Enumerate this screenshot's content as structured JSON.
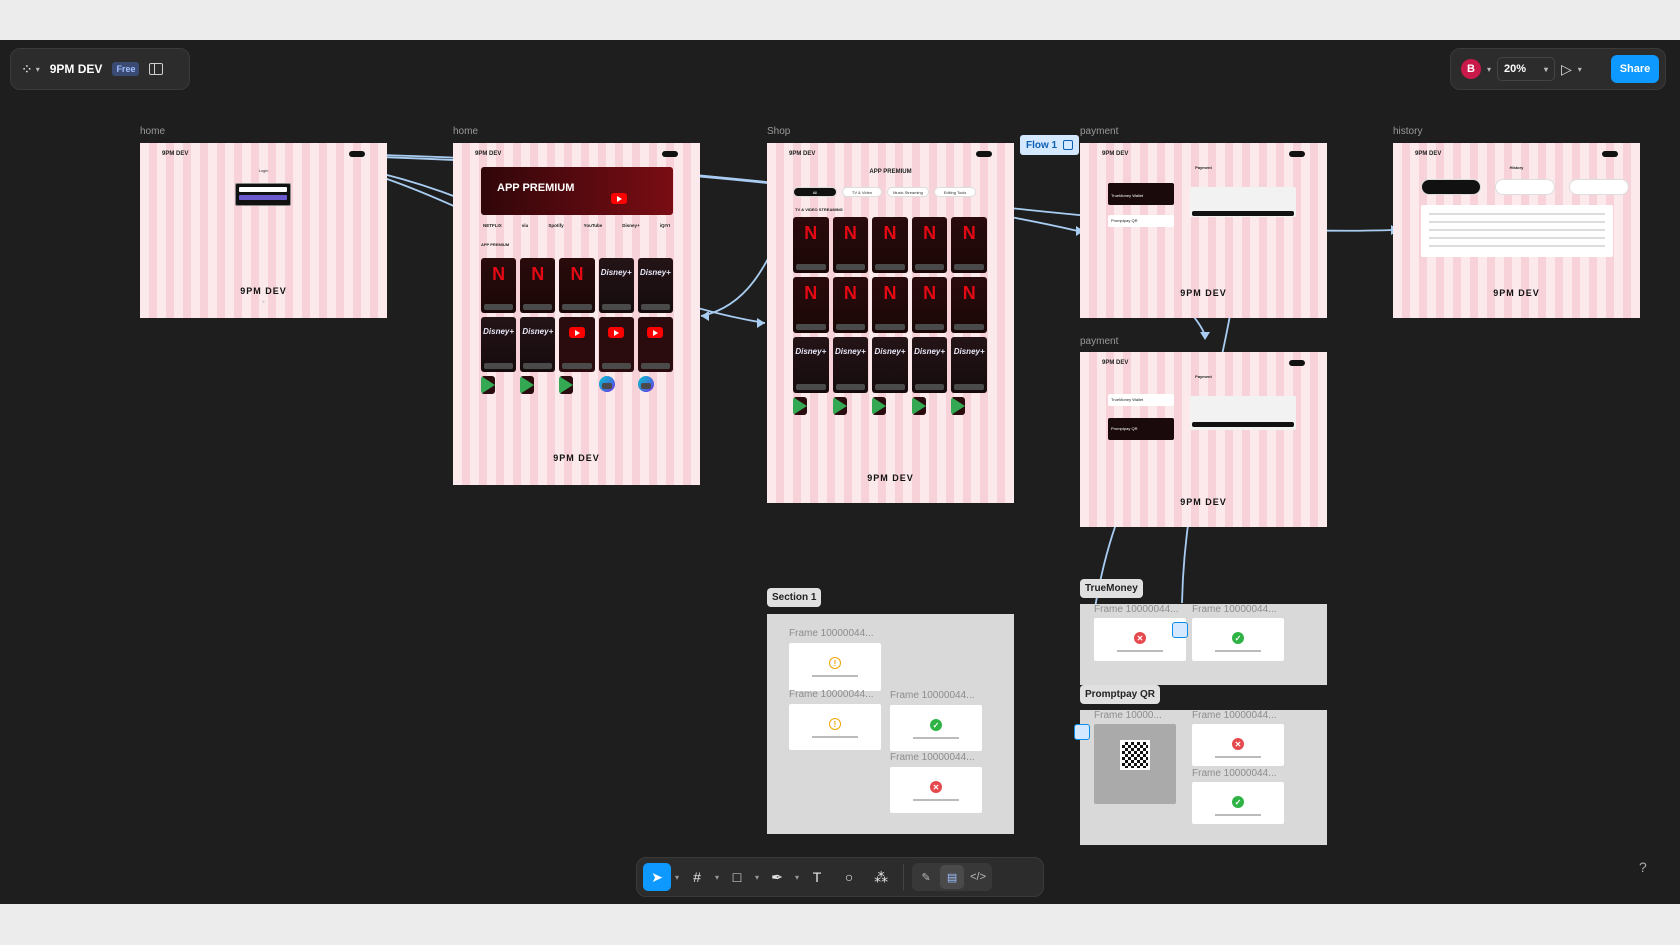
{
  "app": {
    "file_title": "9PM DEV",
    "plan_badge": "Free",
    "user_initial": "B",
    "zoom": "20%",
    "share_label": "Share",
    "help_label": "?"
  },
  "flow": {
    "label": "Flow 1"
  },
  "frames": {
    "home1": {
      "label": "home",
      "brand": "9PM DEV",
      "login_title": "Login",
      "footer": "9PM DEV"
    },
    "home2": {
      "label": "home",
      "brand": "9PM DEV",
      "banner": "APP PREMIUM",
      "footer": "9PM DEV",
      "section": "APP PREMIUM",
      "partners": [
        "NETFLIX",
        "viu",
        "Spotify",
        "YouTube",
        "Disney+",
        "iQIYI"
      ]
    },
    "shop": {
      "label": "Shop",
      "brand": "9PM DEV",
      "title": "APP PREMIUM",
      "category": "TV & VIDEO STREAMING",
      "tabs": [
        "All",
        "TV & Video",
        "Music Streaming",
        "Editing Tools"
      ],
      "footer": "9PM DEV"
    },
    "payment1": {
      "label": "payment",
      "brand": "9PM DEV",
      "title": "Payment",
      "method1": "TrueMoney Wallet",
      "method2": "Promptpay QR",
      "footer": "9PM DEV"
    },
    "payment2": {
      "label": "payment",
      "brand": "9PM DEV",
      "title": "Payment",
      "method1": "TrueMoney Wallet",
      "method2": "Promptpay QR",
      "footer": "9PM DEV"
    },
    "history": {
      "label": "history",
      "brand": "9PM DEV",
      "title": "History",
      "footer": "9PM DEV"
    }
  },
  "sections": {
    "section1": {
      "tag": "Section 1",
      "frames": [
        "Frame 10000044...",
        "Frame 10000044...",
        "Frame 10000044...",
        "Frame 10000044..."
      ]
    },
    "truemoney": {
      "tag": "TrueMoney",
      "frames": [
        "Frame 10000044...",
        "Frame 10000044..."
      ]
    },
    "promptpay": {
      "tag": "Promptpay QR",
      "frames": [
        "Frame 10000...",
        "Frame 10000044...",
        "Frame 10000044..."
      ]
    }
  },
  "home_cards": [
    "netflix",
    "netflix",
    "netflix",
    "disney",
    "disney",
    "disney",
    "disney",
    "youtube",
    "youtube",
    "youtube",
    "gplay",
    "gplay",
    "gplay",
    "canva",
    "canva"
  ],
  "shop_cards": [
    "netflix",
    "netflix",
    "netflix",
    "netflix",
    "netflix",
    "netflix",
    "netflix",
    "netflix",
    "netflix",
    "netflix",
    "disney",
    "disney",
    "disney",
    "disney",
    "disney",
    "gplay",
    "gplay",
    "gplay",
    "gplay",
    "gplay"
  ],
  "card_logos": {
    "netflix": "N",
    "disney": "Disney+"
  },
  "toolbar": {
    "tools": [
      "move-tool",
      "frame-tool",
      "shape-tool",
      "pen-tool",
      "text-tool",
      "comment-tool",
      "actions-tool"
    ],
    "modes": [
      "draw-mode",
      "design-mode",
      "dev-mode"
    ]
  },
  "colors": {
    "canvas": "#1e1e1e",
    "accent": "#0d99ff",
    "connector": "#a9cdf2",
    "grid_pink": "#f7d3d9"
  }
}
